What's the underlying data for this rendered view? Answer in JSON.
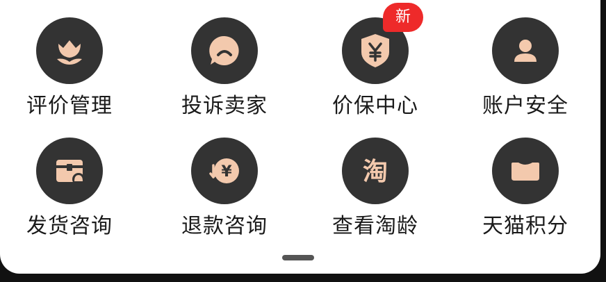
{
  "colors": {
    "panel_bg": "#ffffff",
    "icon_circle": "#333333",
    "icon_glyph": "#f3c9ad",
    "badge_bg": "#ee2a2a",
    "label": "#1a1a1a",
    "handle": "#555555"
  },
  "items": [
    {
      "label": "评价管理",
      "icon": "tulip-icon"
    },
    {
      "label": "投诉卖家",
      "icon": "chat-bubble-icon"
    },
    {
      "label": "价保中心",
      "icon": "yen-shield-icon",
      "badge": "新"
    },
    {
      "label": "账户安全",
      "icon": "user-icon"
    },
    {
      "label": "发货咨询",
      "icon": "package-bell-icon"
    },
    {
      "label": "退款咨询",
      "icon": "yen-refund-icon",
      "glyph": "¥"
    },
    {
      "label": "查看淘龄",
      "icon": "tao-icon",
      "glyph": "淘"
    },
    {
      "label": "天猫积分",
      "icon": "tmall-icon"
    }
  ]
}
